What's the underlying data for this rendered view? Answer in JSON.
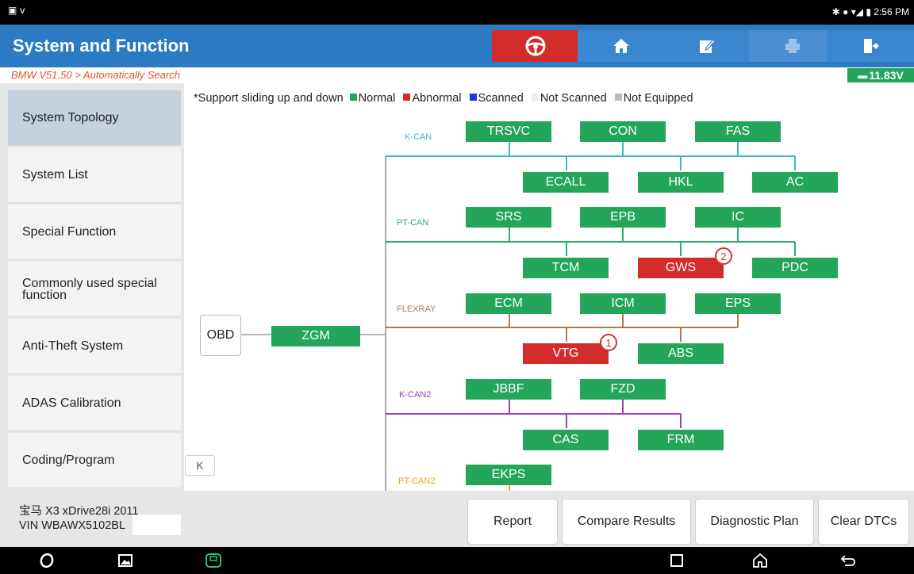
{
  "statusbar": {
    "time": "2:56 PM"
  },
  "header": {
    "title": "System and Function",
    "buttons": [
      {
        "icon": "steering-wheel-icon"
      },
      {
        "icon": "home-icon"
      },
      {
        "icon": "edit-icon"
      },
      {
        "icon": "printer-icon"
      },
      {
        "icon": "exit-icon"
      }
    ],
    "accent_color": "#2C79C4",
    "active_button_color": "#D42B2B"
  },
  "breadcrumb": "BMW V51.50 > Automatically Search",
  "voltage": "11.83V",
  "sidebar": {
    "items": [
      {
        "label": "System Topology",
        "active": true
      },
      {
        "label": "System List"
      },
      {
        "label": "Special Function"
      },
      {
        "label": "Commonly used special function"
      },
      {
        "label": "Anti-Theft System"
      },
      {
        "label": "ADAS Calibration"
      },
      {
        "label": "Coding/Program"
      }
    ],
    "collapse_label": "K"
  },
  "legend": {
    "note": "*Support sliding up and down",
    "items": [
      {
        "label": "Normal",
        "color": "#23A65A"
      },
      {
        "label": "Abnormal",
        "color": "#D42B2B"
      },
      {
        "label": "Scanned",
        "color": "#2233DD"
      },
      {
        "label": "Not Scanned",
        "color": "#EEEEEE"
      },
      {
        "label": "Not Equipped",
        "color": "#BBBBBB"
      }
    ]
  },
  "topology": {
    "obd": "OBD",
    "gateway": "ZGM",
    "buses": [
      {
        "name": "K-CAN",
        "color": "#3CB8C9",
        "modules_top": [
          "TRSVC",
          "CON",
          "FAS"
        ],
        "modules_bottom": [
          "ECALL",
          "HKL",
          "AC"
        ]
      },
      {
        "name": "PT-CAN",
        "color": "#2BAE6A",
        "modules_top": [
          "SRS",
          "EPB",
          "IC"
        ],
        "modules_bottom": [
          "TCM",
          "GWS",
          "PDC"
        ]
      },
      {
        "name": "FLEXRAY",
        "color": "#B07A4B",
        "modules_top": [
          "ECM",
          "ICM",
          "EPS"
        ],
        "modules_bottom": [
          "VTG",
          "ABS"
        ]
      },
      {
        "name": "K-CAN2",
        "color": "#9A3FC0",
        "modules_top": [
          "JBBF",
          "FZD"
        ],
        "modules_bottom": [
          "CAS",
          "FRM"
        ]
      },
      {
        "name": "PT-CAN2",
        "color": "#E8A317",
        "modules_top": [
          "EKPS"
        ],
        "modules_bottom": []
      }
    ],
    "abnormal": [
      {
        "module": "GWS",
        "badge": "2"
      },
      {
        "module": "VTG",
        "badge": "1"
      }
    ]
  },
  "vehicle": {
    "model": "宝马 X3 xDrive28i 2011",
    "vin": "VIN WBAWX5102BL"
  },
  "footer_buttons": [
    "Report",
    "Compare Results",
    "Diagnostic Plan",
    "Clear DTCs"
  ]
}
